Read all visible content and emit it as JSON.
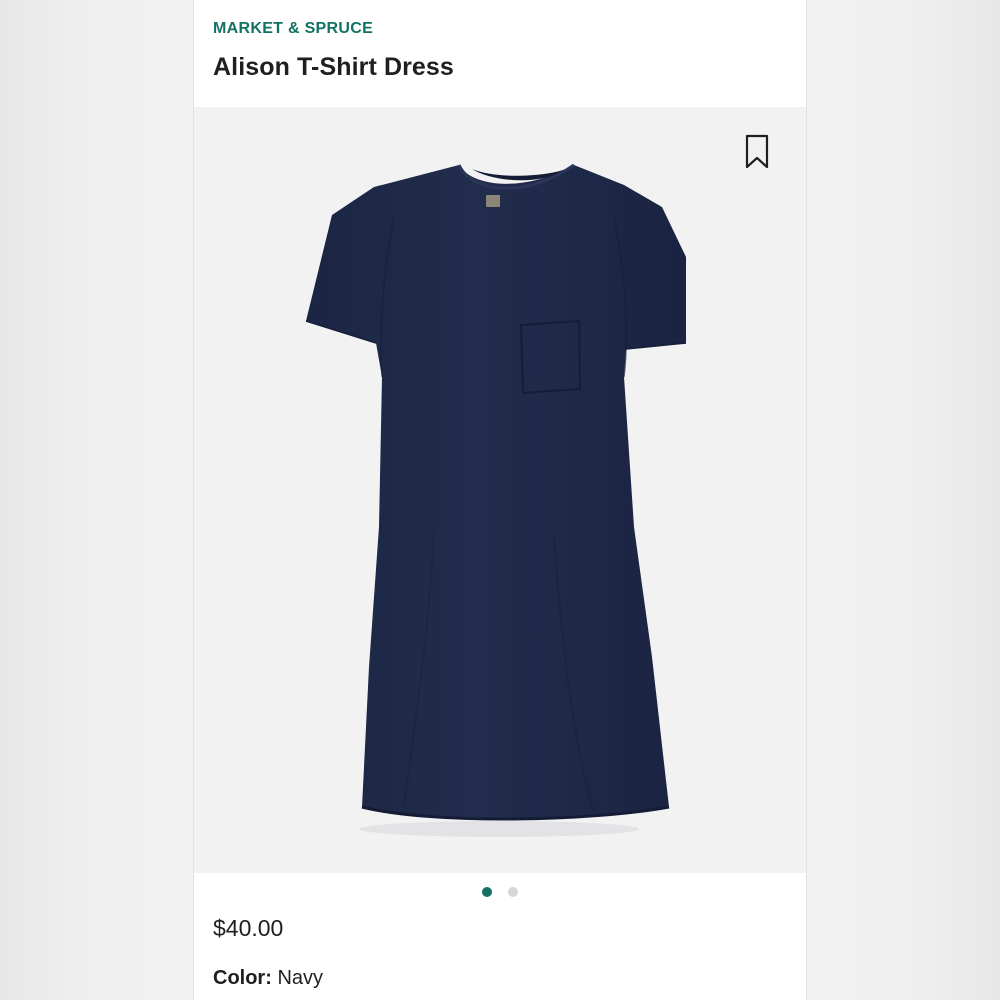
{
  "product": {
    "brand": "MARKET & SPRUCE",
    "name": "Alison T-Shirt Dress",
    "price": "$40.00",
    "color_label": "Color:",
    "color_value": "Navy"
  },
  "gallery": {
    "current_index": 1,
    "total_images": 2,
    "image_subject": "navy-tshirt-dress"
  },
  "icons": {
    "bookmark": "bookmark-icon"
  },
  "colors": {
    "brand_accent": "#137263",
    "dress": "#1f2a4a",
    "text": "#1f1f21",
    "image_bg": "#f2f2f3",
    "dot_inactive": "#d6d6d8"
  }
}
